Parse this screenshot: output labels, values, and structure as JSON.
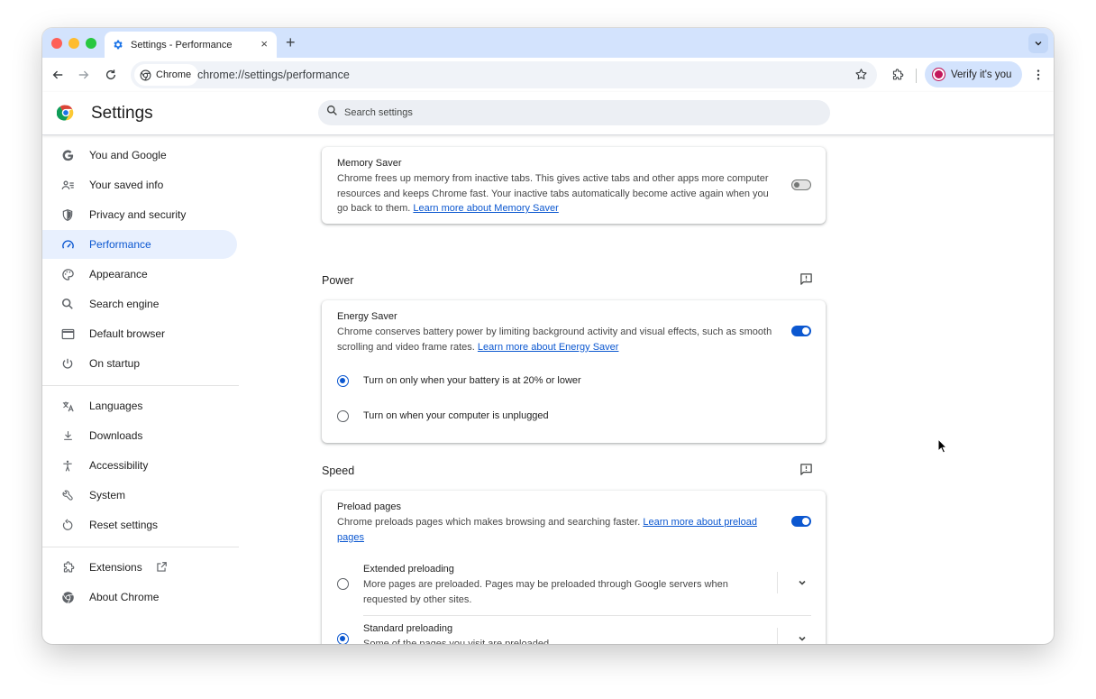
{
  "browser": {
    "tab_title": "Settings - Performance",
    "tab_close": "×",
    "new_tab": "+",
    "omnibox_chip": "Chrome",
    "url": "chrome://settings/performance",
    "profile_button": "Verify it's you"
  },
  "header": {
    "title": "Settings",
    "search_placeholder": "Search settings"
  },
  "sidebar": {
    "items": [
      {
        "label": "You and Google",
        "icon": "google-g-icon"
      },
      {
        "label": "Your saved info",
        "icon": "saved-info-icon"
      },
      {
        "label": "Privacy and security",
        "icon": "shield-icon"
      },
      {
        "label": "Performance",
        "icon": "speedometer-icon",
        "active": true
      },
      {
        "label": "Appearance",
        "icon": "palette-icon"
      },
      {
        "label": "Search engine",
        "icon": "search-icon"
      },
      {
        "label": "Default browser",
        "icon": "browser-window-icon"
      },
      {
        "label": "On startup",
        "icon": "power-icon"
      },
      {
        "label": "Languages",
        "icon": "translate-icon"
      },
      {
        "label": "Downloads",
        "icon": "download-icon"
      },
      {
        "label": "Accessibility",
        "icon": "accessibility-icon"
      },
      {
        "label": "System",
        "icon": "wrench-icon"
      },
      {
        "label": "Reset settings",
        "icon": "reset-icon"
      },
      {
        "label": "Extensions",
        "icon": "puzzle-icon"
      },
      {
        "label": "About Chrome",
        "icon": "chrome-icon"
      }
    ]
  },
  "memory": {
    "title": "Memory Saver",
    "desc": "Chrome frees up memory from inactive tabs. This gives active tabs and other apps more computer resources and keeps Chrome fast. Your inactive tabs automatically become active again when you go back to them.",
    "link": "Learn more about Memory Saver",
    "enabled": false
  },
  "power": {
    "section_title": "Power",
    "energy_title": "Energy Saver",
    "energy_desc": "Chrome conserves battery power by limiting background activity and visual effects, such as smooth scrolling and video frame rates.",
    "energy_link": "Learn more about Energy Saver",
    "enabled": true,
    "options": [
      {
        "label": "Turn on only when your battery is at 20% or lower",
        "checked": true
      },
      {
        "label": "Turn on when your computer is unplugged",
        "checked": false
      }
    ]
  },
  "speed": {
    "section_title": "Speed",
    "preload_title": "Preload pages",
    "preload_desc": "Chrome preloads pages which makes browsing and searching faster.",
    "preload_link": "Learn more about preload pages",
    "enabled": true,
    "options": [
      {
        "label": "Extended preloading",
        "desc": "More pages are preloaded. Pages may be preloaded through Google servers when requested by other sites.",
        "checked": false
      },
      {
        "label": "Standard preloading",
        "desc": "Some of the pages you visit are preloaded",
        "checked": true
      }
    ]
  },
  "colors": {
    "accent": "#0b57d0",
    "tab_bar": "#d3e3fd",
    "active_nav_bg": "#e8f0fe"
  }
}
